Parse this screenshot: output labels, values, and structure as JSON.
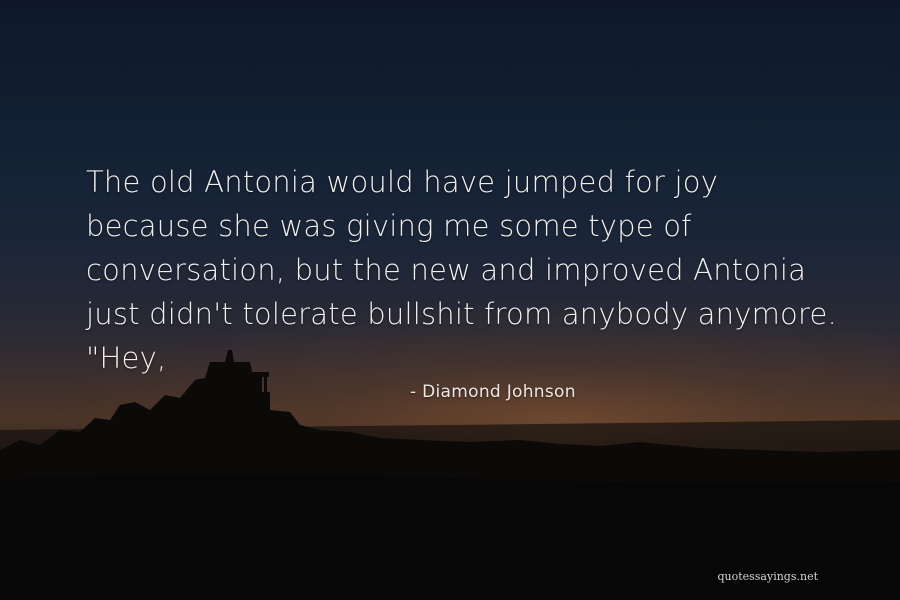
{
  "quote": {
    "text": "The old Antonia would have jumped for joy\nbecause she was giving me some type of\nconversation, but the new and improved Antonia\njust didn't tolerate bullshit from anybody anymore.\n\"Hey,",
    "author": "- Diamond Johnson"
  },
  "watermark": {
    "text": "quotessayings.net"
  },
  "colors": {
    "sky_top": "#0e1828",
    "sunset": "#4a3427",
    "ground": "#0a0908",
    "text": "#f2f0ee"
  }
}
